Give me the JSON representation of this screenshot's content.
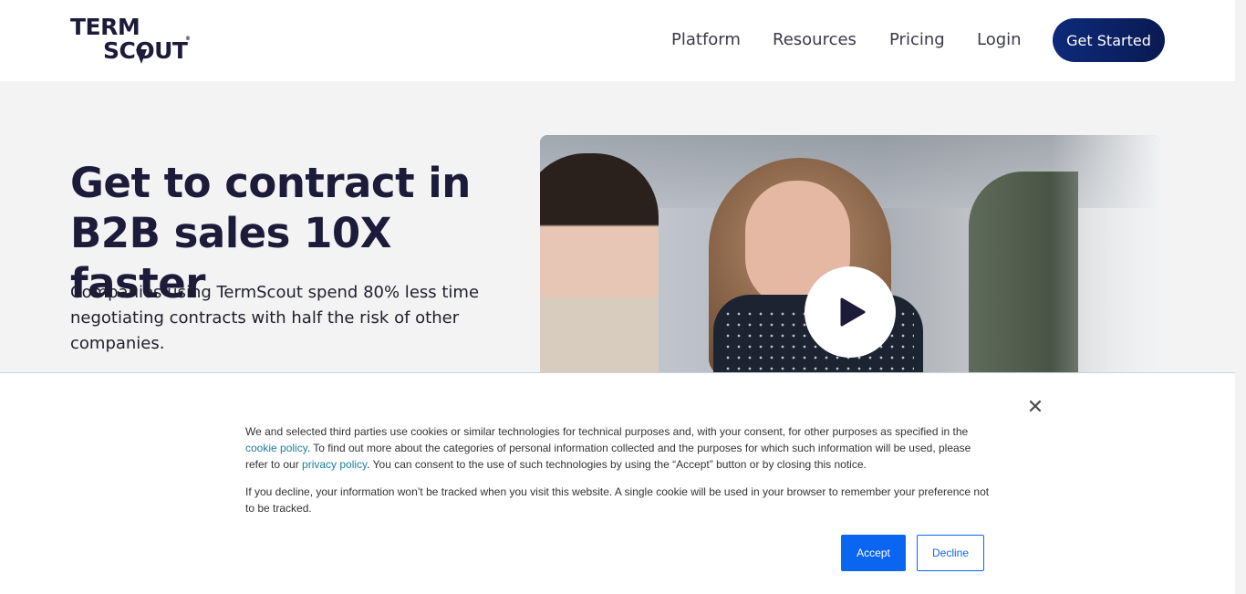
{
  "header": {
    "logo": {
      "line1": "TERM",
      "line2": "SCOUT",
      "reg": "®"
    },
    "nav": {
      "platform": "Platform",
      "resources": "Resources",
      "pricing": "Pricing",
      "login": "Login"
    },
    "cta_label": "Get Started"
  },
  "hero": {
    "title_line1": "Get to contract in",
    "title_line2": "B2B sales 10X faster",
    "subtitle": "Companies using TermScout spend 80% less time negotiating contracts with half the risk of other companies.",
    "play_icon": "play-icon"
  },
  "cookie_notice": {
    "close_glyph": "✕",
    "p1_before": "We and selected third parties use cookies or similar technologies for technical purposes and, with your consent, for other purposes as specified in the ",
    "cookie_link": "cookie policy",
    "p1_middle": ". To find out more about the categories of personal information collected and the purposes for which such information will be used, please refer to our ",
    "privacy_link": "privacy policy",
    "p1_after": ". You can consent to the use of such technologies by using the “Accept” button or by closing this notice.",
    "p2": "If you decline, your information won’t be tracked when you visit this website. A single cookie will be used in your browser to remember your preference not to be tracked.",
    "accept_label": "Accept",
    "decline_label": "Decline"
  },
  "colors": {
    "brand_navy": "#1c1b3a",
    "cta_blue": "#0a1a52",
    "accept_blue": "#0a66f0",
    "link_teal": "#1e7ea0"
  }
}
